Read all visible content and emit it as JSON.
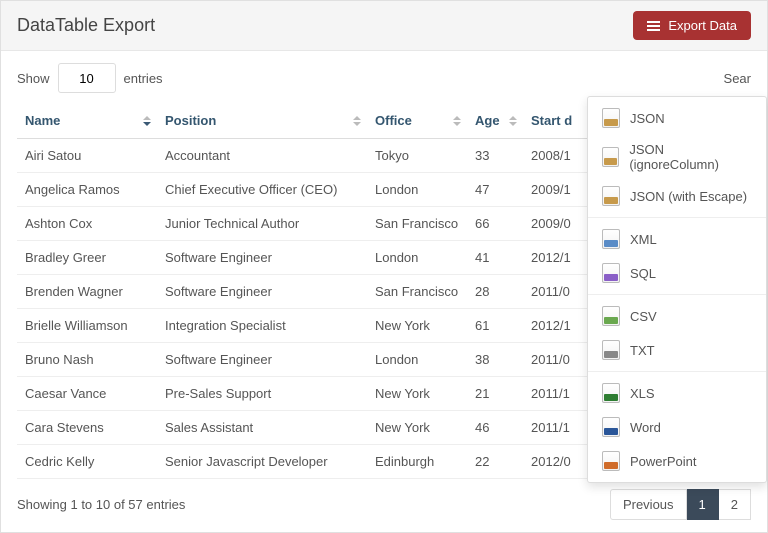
{
  "header": {
    "title": "DataTable Export",
    "exportLabel": "Export Data"
  },
  "entries": {
    "showLabel": "Show",
    "entriesLabel": "entries",
    "value": "10",
    "searchLabel": "Sear"
  },
  "columns": {
    "name": "Name",
    "position": "Position",
    "office": "Office",
    "age": "Age",
    "start": "Start d"
  },
  "rows": [
    {
      "name": "Airi Satou",
      "position": "Accountant",
      "office": "Tokyo",
      "age": "33",
      "start": "2008/1"
    },
    {
      "name": "Angelica Ramos",
      "position": "Chief Executive Officer (CEO)",
      "office": "London",
      "age": "47",
      "start": "2009/1"
    },
    {
      "name": "Ashton Cox",
      "position": "Junior Technical Author",
      "office": "San Francisco",
      "age": "66",
      "start": "2009/0"
    },
    {
      "name": "Bradley Greer",
      "position": "Software Engineer",
      "office": "London",
      "age": "41",
      "start": "2012/1"
    },
    {
      "name": "Brenden Wagner",
      "position": "Software Engineer",
      "office": "San Francisco",
      "age": "28",
      "start": "2011/0"
    },
    {
      "name": "Brielle Williamson",
      "position": "Integration Specialist",
      "office": "New York",
      "age": "61",
      "start": "2012/1"
    },
    {
      "name": "Bruno Nash",
      "position": "Software Engineer",
      "office": "London",
      "age": "38",
      "start": "2011/0"
    },
    {
      "name": "Caesar Vance",
      "position": "Pre-Sales Support",
      "office": "New York",
      "age": "21",
      "start": "2011/1"
    },
    {
      "name": "Cara Stevens",
      "position": "Sales Assistant",
      "office": "New York",
      "age": "46",
      "start": "2011/1"
    },
    {
      "name": "Cedric Kelly",
      "position": "Senior Javascript Developer",
      "office": "Edinburgh",
      "age": "22",
      "start": "2012/0"
    }
  ],
  "footer": {
    "info": "Showing 1 to 10 of 57 entries",
    "prev": "Previous",
    "p1": "1",
    "p2": "2"
  },
  "exportMenu": {
    "groups": [
      [
        {
          "key": "json",
          "label": "JSON",
          "icon": "i-json"
        },
        {
          "key": "json-ignore",
          "label": "JSON (ignoreColumn)",
          "icon": "i-json"
        },
        {
          "key": "json-escape",
          "label": "JSON (with Escape)",
          "icon": "i-json"
        }
      ],
      [
        {
          "key": "xml",
          "label": "XML",
          "icon": "i-xml"
        },
        {
          "key": "sql",
          "label": "SQL",
          "icon": "i-sql"
        }
      ],
      [
        {
          "key": "csv",
          "label": "CSV",
          "icon": "i-csv"
        },
        {
          "key": "txt",
          "label": "TXT",
          "icon": "i-txt"
        }
      ],
      [
        {
          "key": "xls",
          "label": "XLS",
          "icon": "i-xls"
        },
        {
          "key": "word",
          "label": "Word",
          "icon": "i-word"
        },
        {
          "key": "ppt",
          "label": "PowerPoint",
          "icon": "i-ppt"
        }
      ]
    ]
  }
}
